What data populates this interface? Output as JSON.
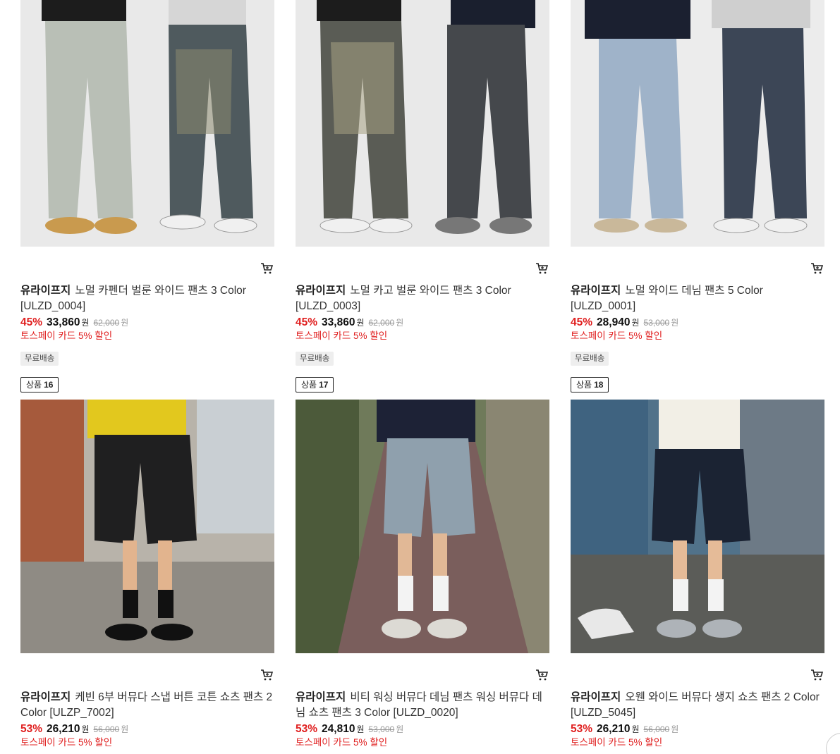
{
  "products": [
    {
      "brand": "유라이프지",
      "name": "노멀 카펜더 벌룬 와이드 팬츠 3 Color [ULZD_0004]",
      "discount": "45%",
      "price": "33,860",
      "won": "원",
      "original_price": "62,000",
      "promo": "토스페이 카드 5% 할인",
      "badge": "무료배송",
      "cart_icon": "cart-icon"
    },
    {
      "brand": "유라이프지",
      "name": "노멀 카고 벌룬 와이드 팬츠 3 Color [ULZD_0003]",
      "discount": "45%",
      "price": "33,860",
      "won": "원",
      "original_price": "62,000",
      "promo": "토스페이 카드 5% 할인",
      "badge": "무료배송",
      "cart_icon": "cart-icon"
    },
    {
      "brand": "유라이프지",
      "name": "노멀 와이드 데님 팬츠 5 Color [ULZD_0001]",
      "discount": "45%",
      "price": "28,940",
      "won": "원",
      "original_price": "53,000",
      "promo": "토스페이 카드 5% 할인",
      "badge": "무료배송",
      "cart_icon": "cart-icon"
    },
    {
      "rank_label": "상품",
      "rank": "16",
      "brand": "유라이프지",
      "name": "케빈 6부 버뮤다 스냅 버튼 코튼 쇼츠 팬츠 2 Color [ULZP_7002]",
      "discount": "53%",
      "price": "26,210",
      "won": "원",
      "original_price": "56,000",
      "promo": "토스페이 카드 5% 할인",
      "cart_icon": "cart-icon"
    },
    {
      "rank_label": "상품",
      "rank": "17",
      "brand": "유라이프지",
      "name": "비티 워싱 버뮤다 데님 팬츠 워싱 버뮤다 데님 쇼츠 팬츠 3 Color [ULZD_0020]",
      "discount": "53%",
      "price": "24,810",
      "won": "원",
      "original_price": "53,000",
      "promo": "토스페이 카드 5% 할인",
      "cart_icon": "cart-icon"
    },
    {
      "rank_label": "상품",
      "rank": "18",
      "brand": "유라이프지",
      "name": "오웬 와이드 버뮤다 생지 쇼츠 팬츠 2 Color [ULZD_5045]",
      "discount": "53%",
      "price": "26,210",
      "won": "원",
      "original_price": "56,000",
      "promo": "토스페이 카드 5% 할인",
      "cart_icon": "cart-icon"
    }
  ],
  "colors": {
    "discount_red": "#e02020",
    "badge_bg": "#eeeeee"
  }
}
